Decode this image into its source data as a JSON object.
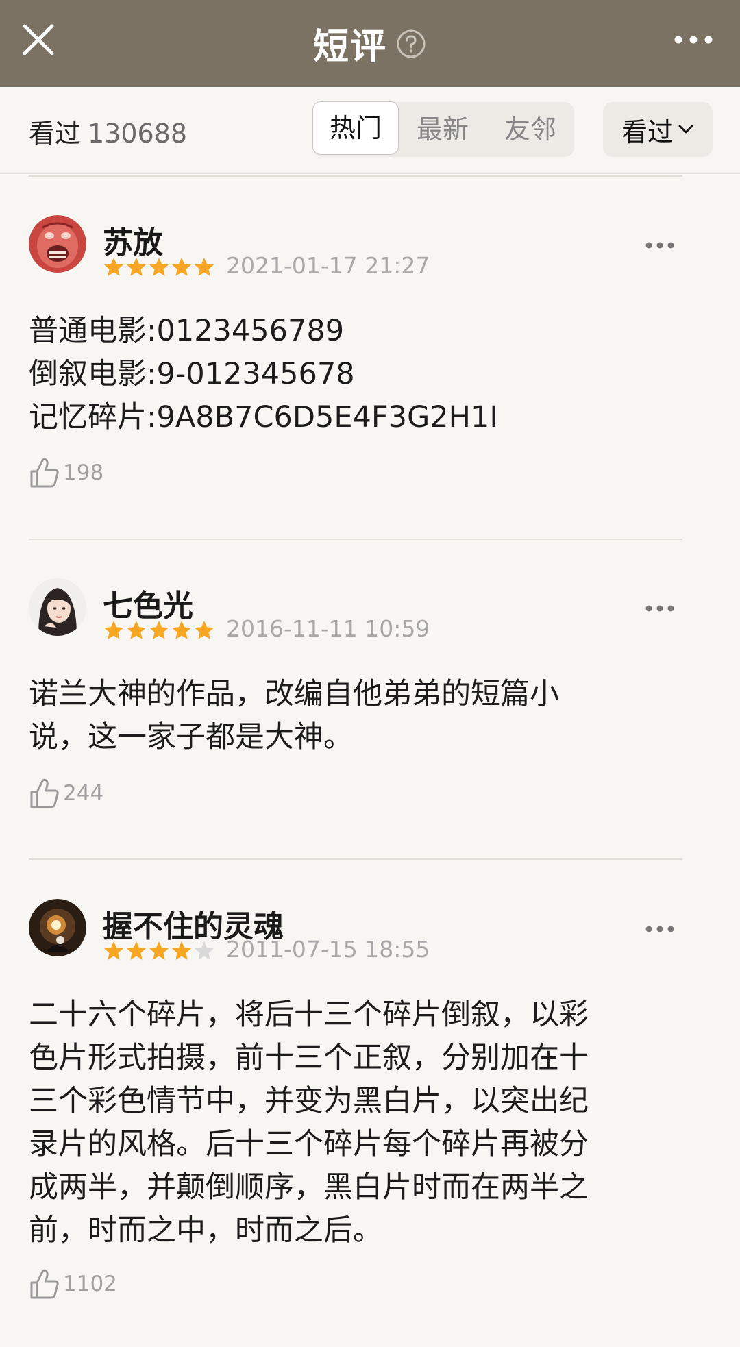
{
  "header": {
    "title": "短评",
    "close_icon": "close-icon",
    "help_icon": "help-circle-icon",
    "more_icon": "more-horizontal-icon",
    "background": "#7b7263"
  },
  "filter_bar": {
    "count_label": "看过",
    "count_value": "130688",
    "tabs": [
      "热门",
      "最新",
      "友邻"
    ],
    "active_tab": "热门",
    "dropdown_label": "看过",
    "dropdown_icon": "chevron-down-icon"
  },
  "reviews": [
    {
      "username": "苏放",
      "rating": 5,
      "date": "2021-01-17 21:27",
      "content_lines": [
        "普通电影:0123456789",
        "倒叙电影:9-012345678",
        "记忆碎片:9A8B7C6D5E4F3G2H1I"
      ],
      "likes": "198"
    },
    {
      "username": "七色光",
      "rating": 5,
      "date": "2016-11-11 10:59",
      "content_lines": [
        "诺兰大神的作品，改编自他弟弟的短篇小",
        "说，这一家子都是大神。"
      ],
      "likes": "244"
    },
    {
      "username": "握不住的灵魂",
      "rating": 4,
      "date": "2011-07-15 18:55",
      "content_lines": [
        "二十六个碎片，将后十三个碎片倒叙，以彩",
        "色片形式拍摄，前十三个正叙，分别加在十",
        "三个彩色情节中，并变为黑白片，以突出纪",
        "录片的风格。后十三个碎片每个碎片再被分",
        "成两半，并颠倒顺序，黑白片时而在两半之",
        "前，时而之中，时而之后。"
      ],
      "likes": "1102"
    }
  ],
  "colors": {
    "star": "#f5a623",
    "star_empty": "#d9d9d9",
    "page_bg": "#f7f6f2"
  }
}
